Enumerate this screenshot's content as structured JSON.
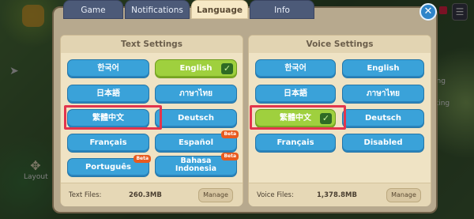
{
  "tabs": [
    "Game",
    "Notifications",
    "Language",
    "Info"
  ],
  "active_tab": "Language",
  "close_label": "✕",
  "text_settings": {
    "title": "Text Settings",
    "languages": [
      "한국어",
      "English",
      "日本語",
      "ภาษาไทย",
      "繁體中文",
      "Deutsch",
      "Français",
      "Español",
      "Português",
      "Bahasa Indonesia"
    ],
    "bahasa_line1": "Bahasa",
    "bahasa_line2": "Indonesia",
    "selected": "English",
    "beta_label": "Beta",
    "files_label": "Text Files:",
    "files_size": "260.3MB",
    "manage_label": "Manage"
  },
  "voice_settings": {
    "title": "Voice Settings",
    "languages": [
      "한국어",
      "English",
      "日本語",
      "ภาษาไทย",
      "繁體中文",
      "Deutsch",
      "Français",
      "Disabled"
    ],
    "selected": "繁體中文",
    "files_label": "Voice Files:",
    "files_size": "1,378.8MB",
    "manage_label": "Manage"
  },
  "background": {
    "layout_label": "Layout",
    "side_labels": [
      "ing",
      "king"
    ]
  },
  "colors": {
    "button_blue": "#3aa2d9",
    "button_selected": "#9fd03e",
    "highlight": "#e3354c",
    "panel": "#efe3c4"
  },
  "icons": [
    "close-icon",
    "check-icon",
    "menu-icon",
    "layout-icon"
  ]
}
